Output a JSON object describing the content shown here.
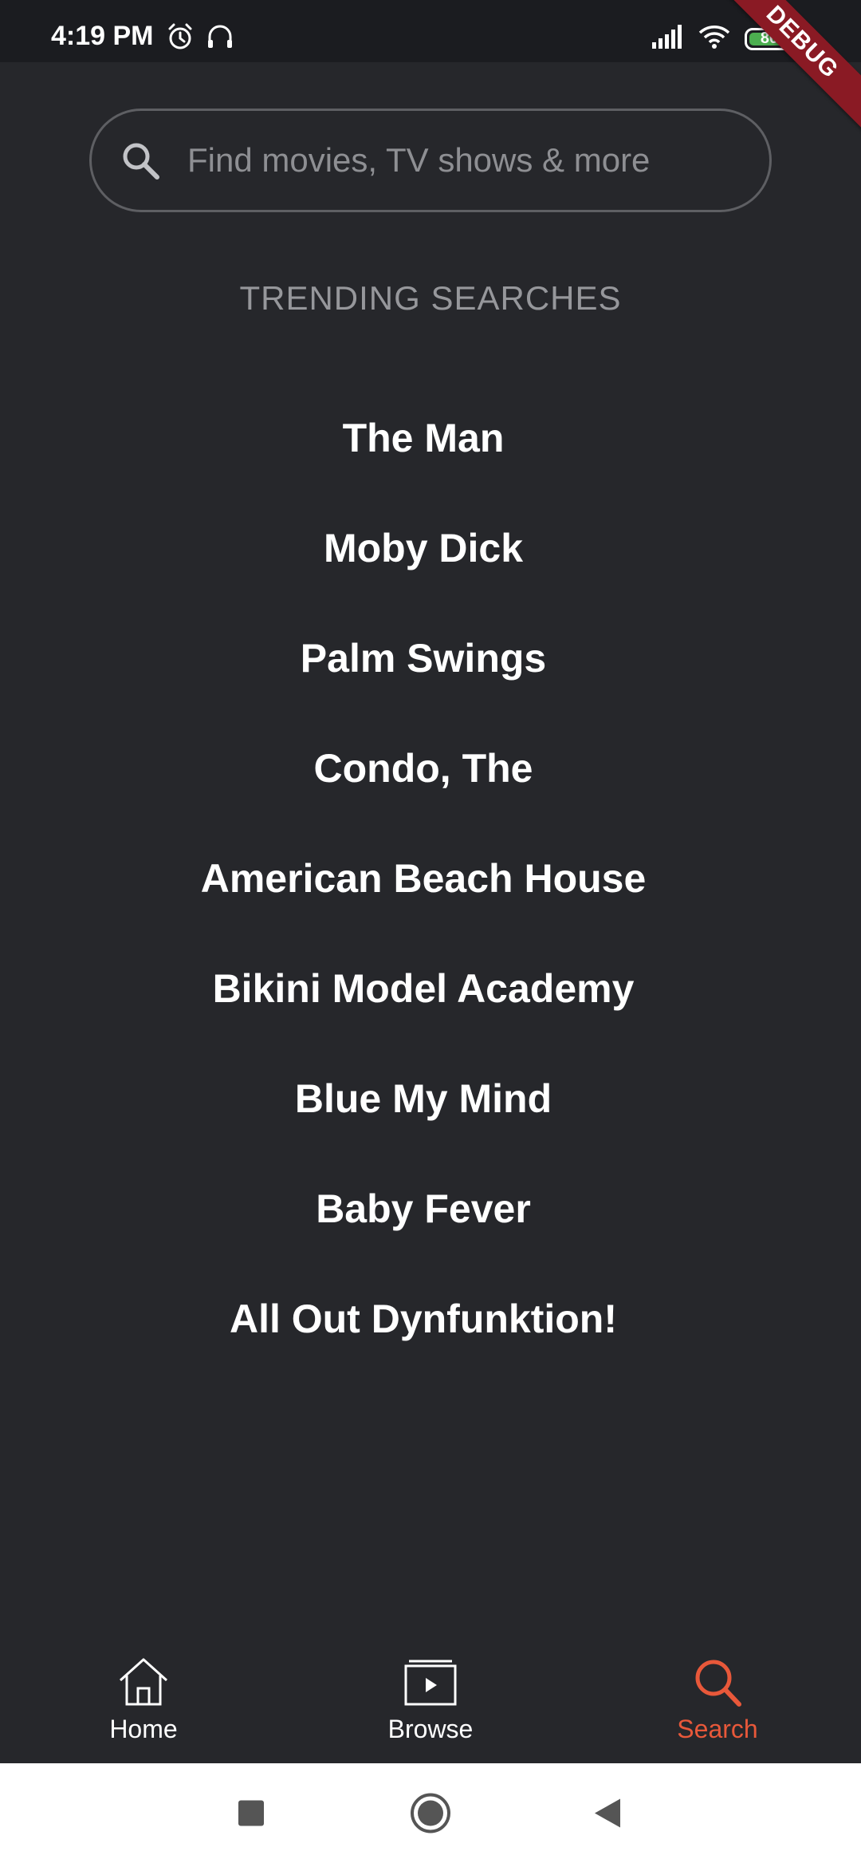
{
  "status_bar": {
    "time": "4:19 PM",
    "battery_level": "80",
    "icons": [
      "alarm-icon",
      "headset-icon",
      "signal-icon",
      "wifi-icon",
      "battery-icon"
    ]
  },
  "debug_banner": "DEBUG",
  "search": {
    "placeholder": "Find movies, TV shows & more",
    "icon": "search-icon"
  },
  "trending": {
    "title": "TRENDING SEARCHES",
    "items": [
      "The Man",
      "Moby Dick",
      "Palm Swings",
      "Condo, The",
      "American Beach House",
      "Bikini Model Academy",
      "Blue My Mind",
      "Baby Fever",
      "All Out Dynfunktion!"
    ]
  },
  "bottom_nav": {
    "items": [
      {
        "label": "Home",
        "icon": "home-icon",
        "active": false
      },
      {
        "label": "Browse",
        "icon": "browse-icon",
        "active": false
      },
      {
        "label": "Search",
        "icon": "search-icon",
        "active": true
      }
    ]
  },
  "colors": {
    "background": "#26272b",
    "accent": "#e8583a",
    "status_bar": "#1b1c20"
  },
  "system_nav": [
    "recents-button",
    "home-button",
    "back-button"
  ]
}
